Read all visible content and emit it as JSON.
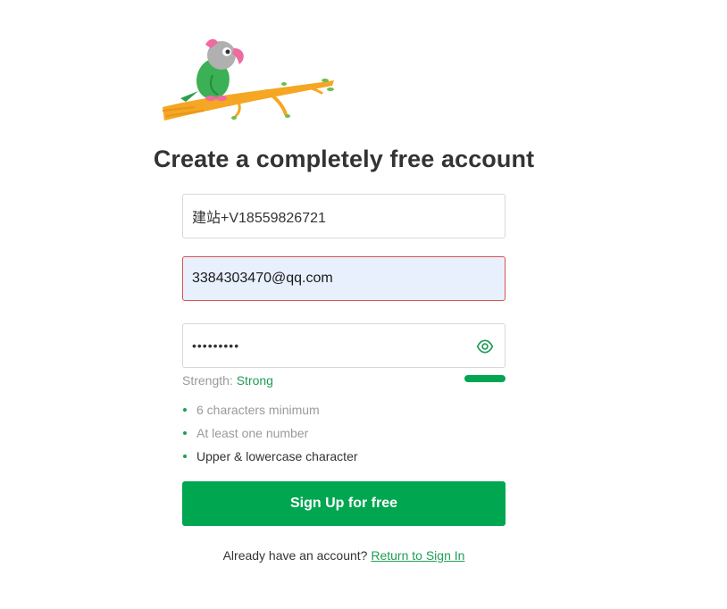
{
  "header": {
    "title": "Create a completely free account"
  },
  "form": {
    "name_value": "建站+V18559826721",
    "email_value": "3384303470@qq.com",
    "password_masked": "•••••••••"
  },
  "strength": {
    "label": "Strength:",
    "value": "Strong",
    "level": 1.0
  },
  "rules": [
    {
      "text": "6 characters minimum",
      "met": false
    },
    {
      "text": "At least one number",
      "met": false
    },
    {
      "text": "Upper & lowercase character",
      "met": true
    }
  ],
  "signup_button_label": "Sign Up for free",
  "signin": {
    "prompt": "Already have an account?",
    "link_label": "Return to Sign In"
  },
  "colors": {
    "primary": "#00a650",
    "error_border": "#d9534f",
    "autofill_bg": "#e8f0fe"
  },
  "icons": {
    "logo": "parrot-logo",
    "password_toggle": "eye-icon"
  }
}
